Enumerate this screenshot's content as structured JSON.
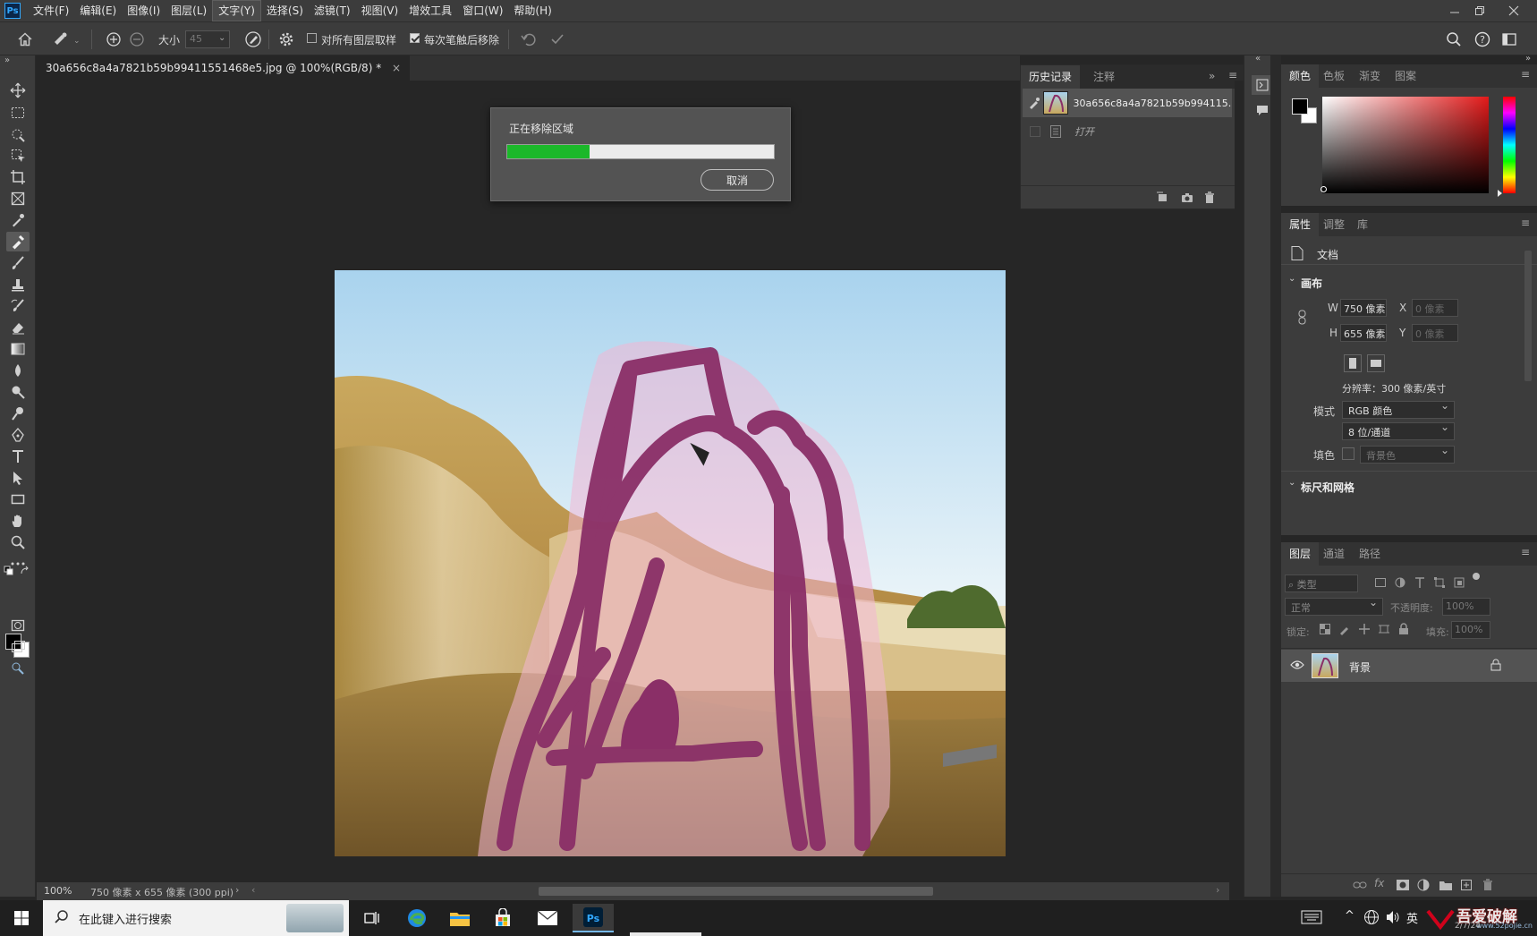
{
  "menu": {
    "logo": "Ps",
    "items": [
      "文件(F)",
      "编辑(E)",
      "图像(I)",
      "图层(L)",
      "文字(Y)",
      "选择(S)",
      "滤镜(T)",
      "视图(V)",
      "增效工具",
      "窗口(W)",
      "帮助(H)"
    ]
  },
  "options": {
    "size_label": "大小",
    "size_value": "45",
    "sample_all_layers": "对所有图层取样",
    "remove_after_stroke": "每次笔触后移除"
  },
  "document": {
    "tab_title": "30a656c8a4a7821b59b99411551468e5.jpg @ 100%(RGB/8) *",
    "close": "×"
  },
  "dialog": {
    "title": "正在移除区域",
    "progress": 0.31,
    "cancel_label": "取消"
  },
  "status": {
    "zoom": "100%",
    "info": "750 像素 x 655 像素 (300 ppi)"
  },
  "history": {
    "tabs": [
      "历史记录",
      "注释"
    ],
    "items": [
      {
        "label": "30a656c8a4a7821b59b994115..."
      },
      {
        "label": "打开"
      }
    ]
  },
  "color_panel": {
    "tabs": [
      "颜色",
      "色板",
      "渐变",
      "图案"
    ]
  },
  "properties": {
    "tabs": [
      "属性",
      "调整",
      "库"
    ],
    "doc_label": "文档",
    "canvas_section": "画布",
    "w_label": "W",
    "w_value": "750 像素",
    "h_label": "H",
    "h_value": "655 像素",
    "x_label": "X",
    "x_value": "0 像素",
    "y_label": "Y",
    "y_value": "0 像素",
    "resolution": "分辨率：300 像素/英寸",
    "mode_label": "模式",
    "mode_value": "RGB 颜色",
    "depth_value": "8 位/通道",
    "fill_label": "填色",
    "fill_value": "背景色",
    "rulers_section": "标尺和网格"
  },
  "layers": {
    "tabs": [
      "图层",
      "通道",
      "路径"
    ],
    "filter_placeholder": "类型",
    "blend_mode": "正常",
    "opacity_label": "不透明度:",
    "opacity_value": "100%",
    "lock_label": "锁定:",
    "fill_label": "填充:",
    "fill_value": "100%",
    "layer_name": "背景",
    "footer_icons": [
      "link-icon",
      "fx-icon",
      "mask-icon",
      "adjustment-icon",
      "folder-icon",
      "new-layer-icon",
      "trash-icon"
    ]
  },
  "taskbar": {
    "search_placeholder": "在此键入进行搜索",
    "ime": "英",
    "watermark": "吾爱破解",
    "watermark_url": "www.52pojie.cn",
    "date_partial": "2/7/24"
  }
}
